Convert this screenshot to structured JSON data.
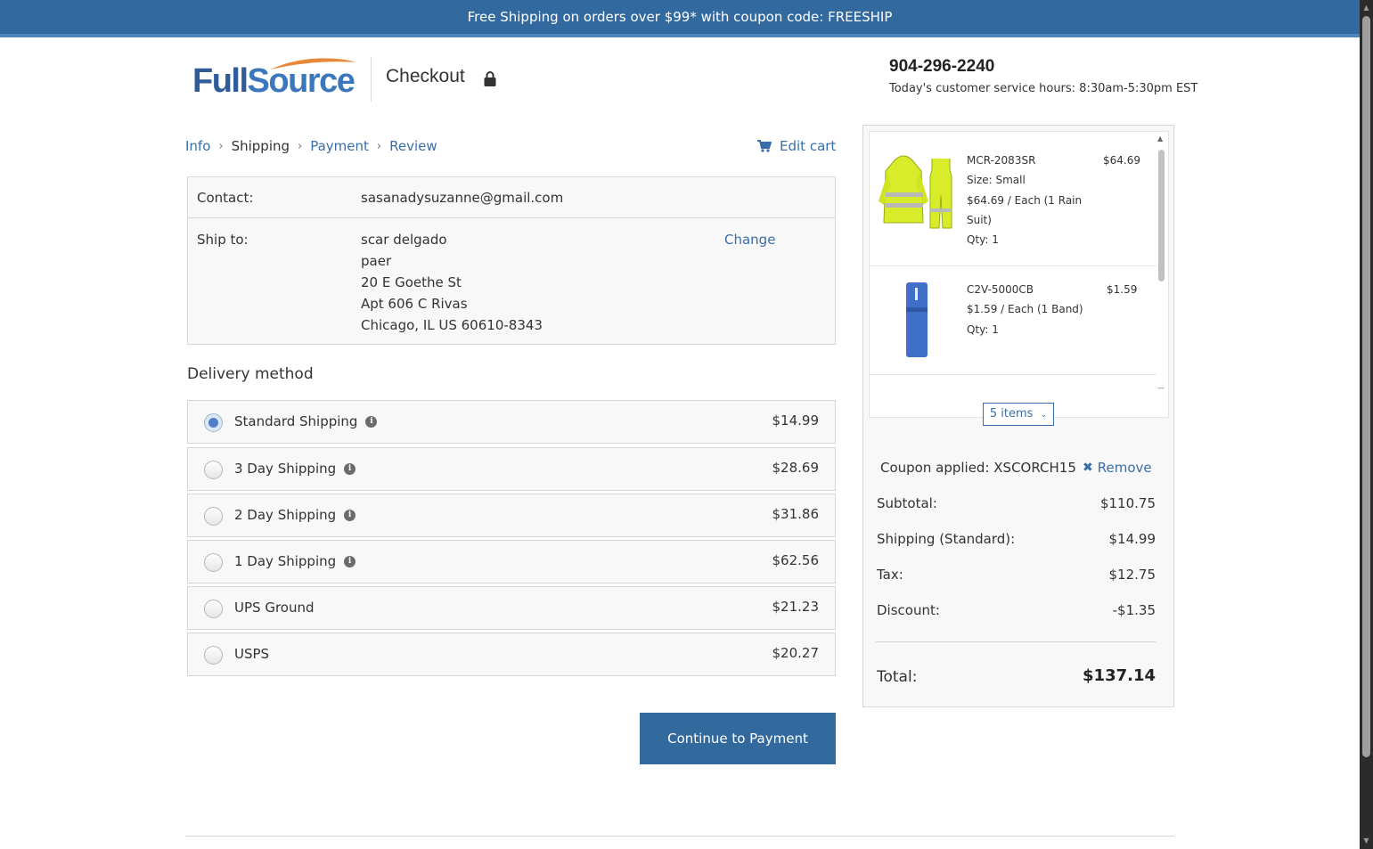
{
  "banner": {
    "text": "Free Shipping on orders over $99* with coupon code: FREESHIP"
  },
  "header": {
    "logo": {
      "part1": "Full",
      "part2": "Source"
    },
    "checkout_title": "Checkout",
    "lock_icon": "lock-icon",
    "phone": "904-296-2240",
    "hours": "Today's customer service hours: 8:30am-5:30pm EST"
  },
  "breadcrumb": {
    "items": [
      {
        "label": "Info",
        "state": "link"
      },
      {
        "label": "Shipping",
        "state": "current"
      },
      {
        "label": "Payment",
        "state": "link"
      },
      {
        "label": "Review",
        "state": "link"
      }
    ],
    "separator": "›"
  },
  "edit_cart": {
    "label": "Edit cart",
    "icon": "cart-icon"
  },
  "info": {
    "contact_label": "Contact:",
    "contact_value": "sasanadysuzanne@gmail.com",
    "shipto_label": "Ship to:",
    "address_lines": [
      "scar delgado",
      "paer",
      "20 E Goethe St",
      "Apt 606 C Rivas",
      "Chicago, IL US 60610-8343"
    ],
    "change_label": "Change"
  },
  "delivery": {
    "title": "Delivery method",
    "options": [
      {
        "name": "Standard Shipping",
        "price": "$14.99",
        "info": true,
        "selected": true
      },
      {
        "name": "3 Day Shipping",
        "price": "$28.69",
        "info": true,
        "selected": false
      },
      {
        "name": "2 Day Shipping",
        "price": "$31.86",
        "info": true,
        "selected": false
      },
      {
        "name": "1 Day Shipping",
        "price": "$62.56",
        "info": true,
        "selected": false
      },
      {
        "name": "UPS Ground",
        "price": "$21.23",
        "info": false,
        "selected": false
      },
      {
        "name": "USPS",
        "price": "$20.27",
        "info": false,
        "selected": false
      }
    ],
    "continue_label": "Continue to Payment"
  },
  "cart": {
    "items": [
      {
        "sku": "MCR-2083SR",
        "price": "$64.69",
        "lines": [
          "Size: Small",
          "$64.69 / Each (1 Rain",
          "Suit)",
          "Qty: 1"
        ],
        "image": "rain-suit-image"
      },
      {
        "sku": "C2V-5000CB",
        "price": "$1.59",
        "lines": [
          "$1.59 / Each (1 Band)",
          "Qty: 1"
        ],
        "image": "band-image"
      }
    ],
    "toggle_label": "5 items"
  },
  "summary": {
    "coupon_text": "Coupon applied: XSCORCH15",
    "remove_label": "Remove",
    "rows": [
      {
        "label": "Subtotal:",
        "value": "$110.75"
      },
      {
        "label": "Shipping (Standard):",
        "value": "$14.99"
      },
      {
        "label": "Tax:",
        "value": "$12.75"
      },
      {
        "label": "Discount:",
        "value": "-$1.35"
      }
    ],
    "total_label": "Total:",
    "total_value": "$137.14"
  },
  "colors": {
    "brand": "#326a9f",
    "link": "#3a6ea8",
    "accent": "#e8883a"
  }
}
